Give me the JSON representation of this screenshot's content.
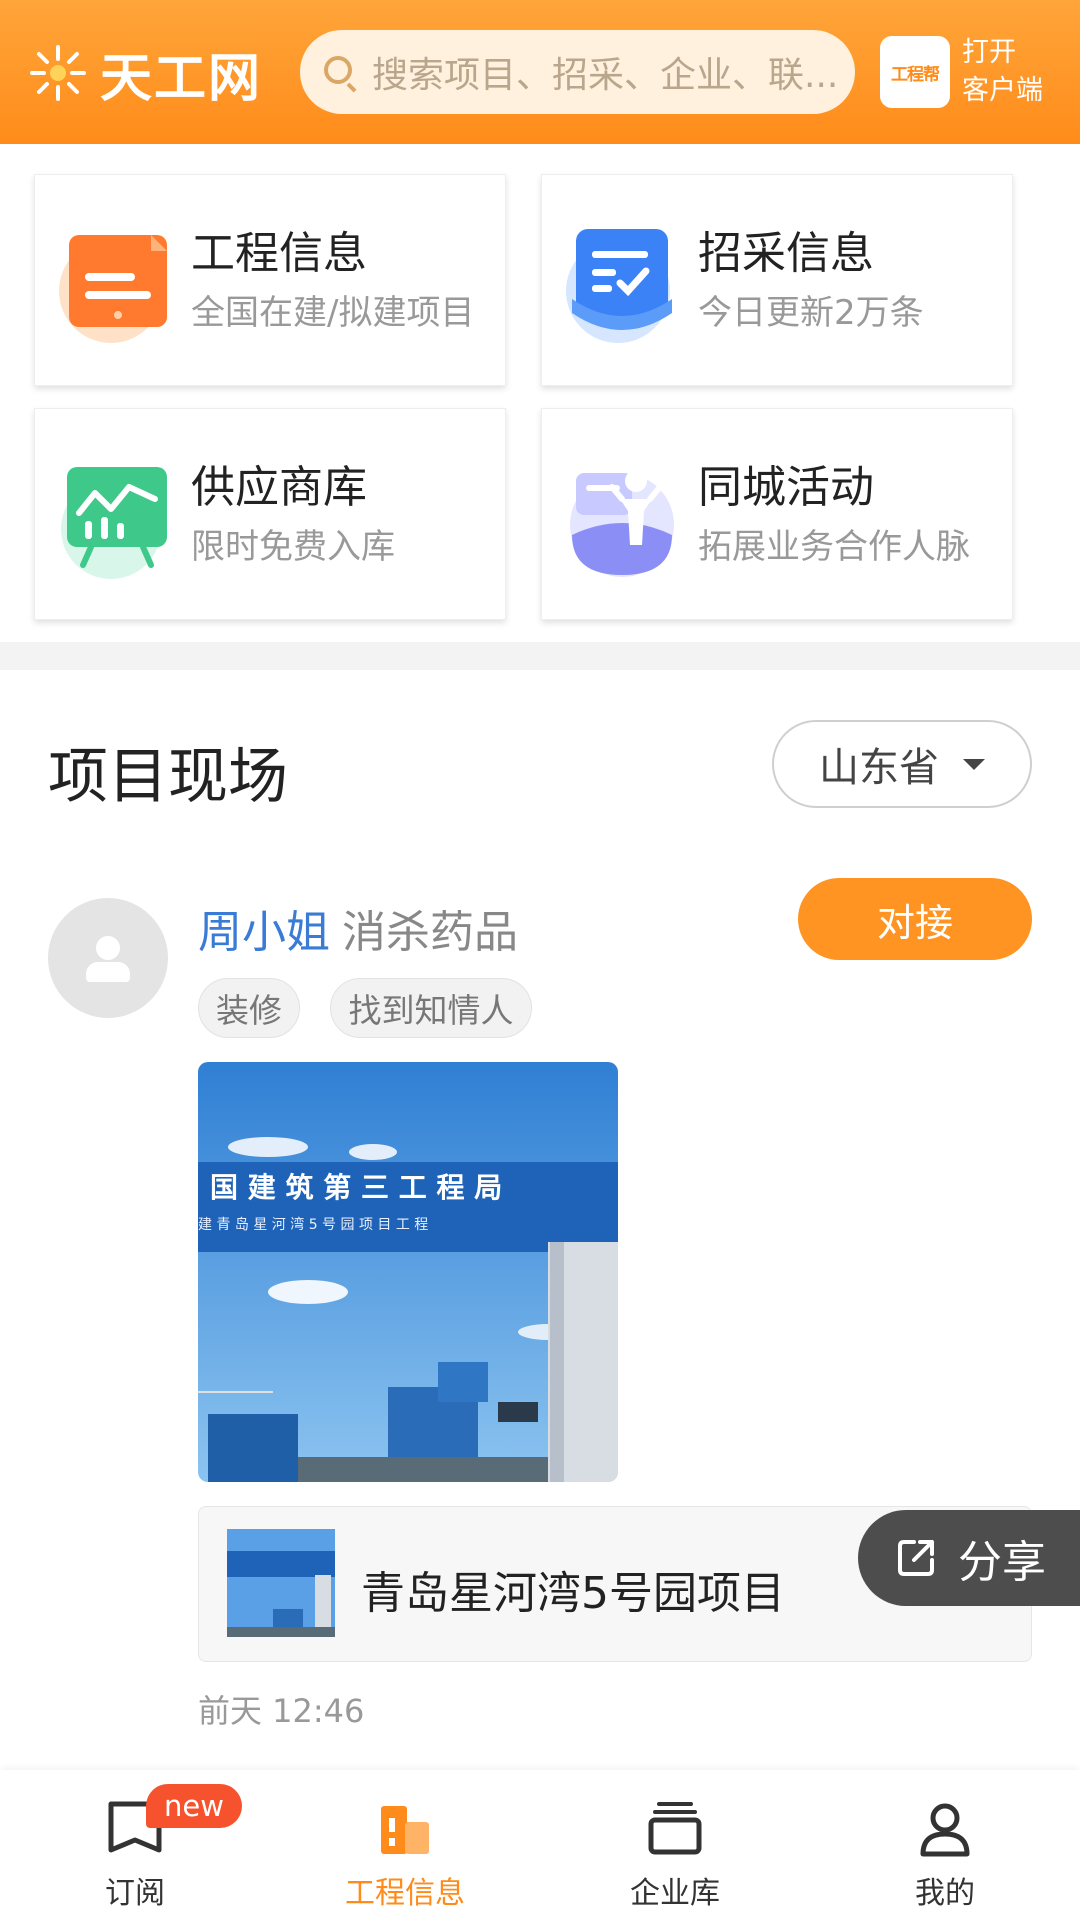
{
  "header": {
    "logo_text": "天工网",
    "search_placeholder": "搜索项目、招采、企业、联...",
    "app_badge_text": "工程帮",
    "open_client_line1": "打开",
    "open_client_line2": "客户端",
    "accent_color": "#ff8c1a"
  },
  "tiles": [
    {
      "title": "工程信息",
      "subtitle": "全国在建/拟建项目",
      "icon": "document-icon",
      "color": "#ff7a2e"
    },
    {
      "title": "招采信息",
      "subtitle": "今日更新2万条",
      "icon": "checklist-icon",
      "color": "#3b82f6"
    },
    {
      "title": "供应商库",
      "subtitle": "限时免费入库",
      "icon": "chart-board-icon",
      "color": "#3ec98a"
    },
    {
      "title": "同城活动",
      "subtitle": "拓展业务合作人脉",
      "icon": "person-chat-icon",
      "color": "#7b7ff0"
    }
  ],
  "section": {
    "title": "项目现场",
    "province": "山东省"
  },
  "post": {
    "author": "周小姐",
    "company": "消杀药品",
    "connect_label": "对接",
    "tags": [
      "装修",
      "找到知情人"
    ],
    "photo_banner_line1": "国 建 筑 第 三 工 程 局",
    "photo_banner_line2": "建 青 岛 星 河 湾 5 号 园 项 目 工 程",
    "project_name": "青岛星河湾5号园项目",
    "share_label": "分享",
    "timestamp": "前天 12:46"
  },
  "bottom_nav": {
    "items": [
      {
        "label": "订阅",
        "icon": "bookmark-icon"
      },
      {
        "label": "工程信息",
        "icon": "building-icon"
      },
      {
        "label": "企业库",
        "icon": "folder-stack-icon"
      },
      {
        "label": "我的",
        "icon": "user-icon"
      }
    ],
    "new_badge": "new",
    "active_index": 1
  }
}
